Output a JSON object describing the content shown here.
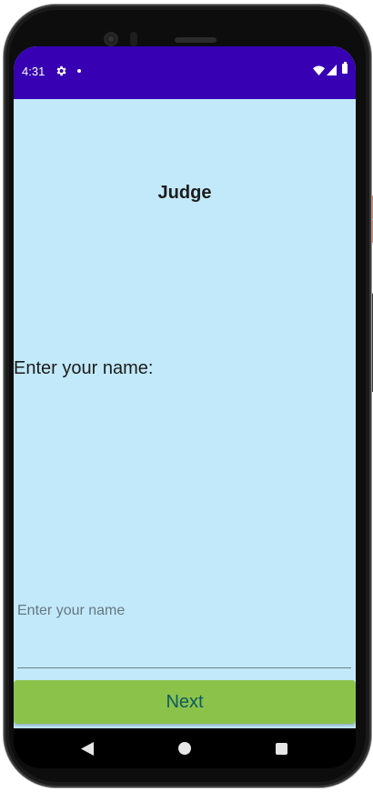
{
  "status_bar": {
    "time": "4:31",
    "background_color": "#3700b3",
    "icons": [
      "gear-icon",
      "dot-icon",
      "wifi-icon",
      "signal-icon",
      "battery-icon"
    ]
  },
  "screen": {
    "background_color": "#c2e9fa",
    "title": "Judge",
    "prompt_label": "Enter your name:",
    "name_input": {
      "value": "",
      "placeholder": "Enter your name"
    },
    "next_button": {
      "label": "Next",
      "background_color": "#8bc34a",
      "text_color": "#0e5a5f"
    }
  },
  "nav_bar": {
    "icons": [
      "back-icon",
      "home-icon",
      "recents-icon"
    ]
  }
}
